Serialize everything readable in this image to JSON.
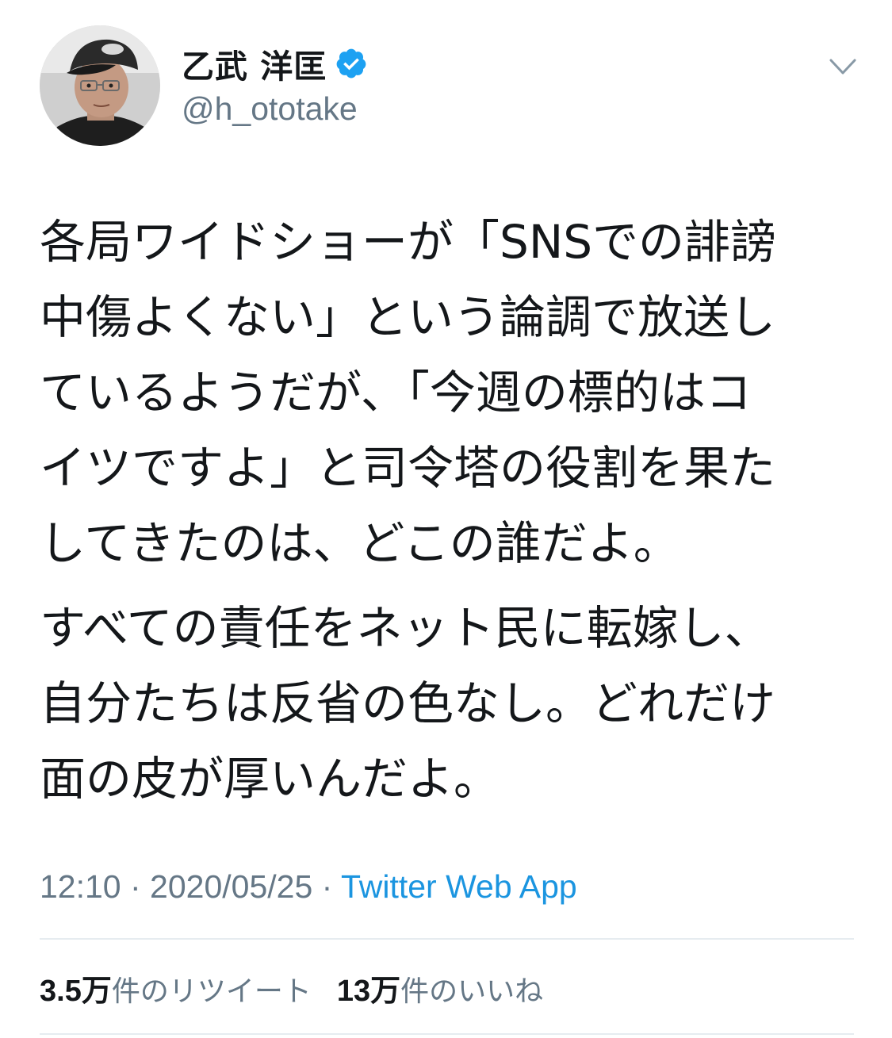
{
  "author": {
    "name": "乙武 洋匡",
    "handle": "@h_ototake",
    "verified": true,
    "avatar_icon": "profile-photo-man-in-cap"
  },
  "menu_icon": "chevron-down-icon",
  "tweet": {
    "paragraphs": [
      {
        "lines": [
          "各局ワイドショーが「SNSでの誹謗",
          "中傷よくない」という論調で放送し",
          "ているようだが、「今週の標的はコ",
          "イツですよ」と司令塔の役割を果た",
          "してきたのは、どこの誰だよ。"
        ]
      },
      {
        "lines": [
          "すべての責任をネット民に転嫁し、",
          "自分たちは反省の色なし。どれだけ",
          "面の皮が厚いんだよ。"
        ]
      }
    ]
  },
  "meta": {
    "time": "12:10",
    "sep1": " · ",
    "date": "2020/05/25",
    "sep2": " · ",
    "source": "Twitter Web App"
  },
  "stats": {
    "retweets": {
      "count": "3.5万",
      "label": "件のリツイート"
    },
    "likes": {
      "count": "13万",
      "label": "件のいいね"
    }
  },
  "colors": {
    "text": "#14171a",
    "secondary": "#657786",
    "link": "#1b95e0",
    "verified": "#1da1f2",
    "divider": "#e6ecf0"
  }
}
